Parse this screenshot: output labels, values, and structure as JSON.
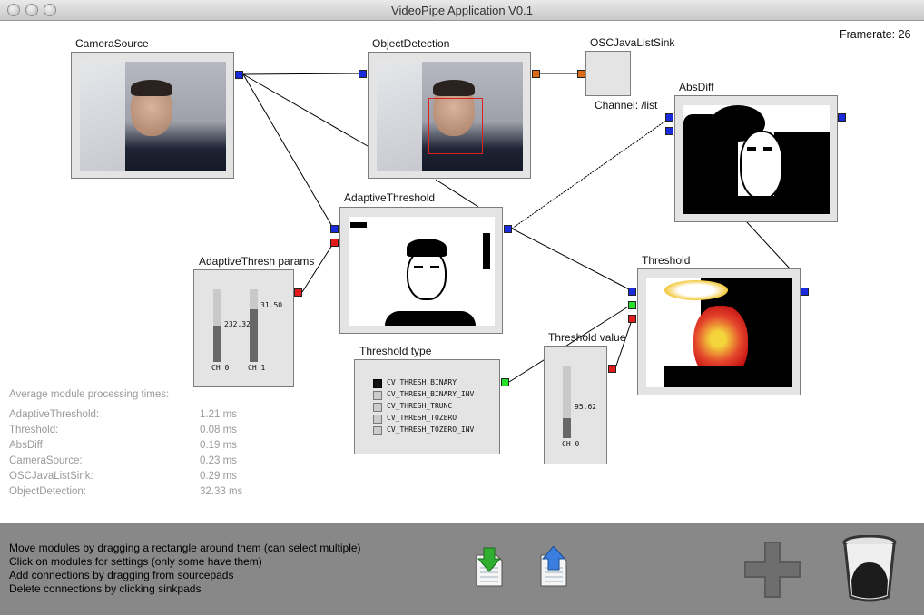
{
  "window": {
    "title": "VideoPipe Application V0.1"
  },
  "framerate": "Framerate: 26",
  "modules": {
    "camera_source": "CameraSource",
    "object_detection": "ObjectDetection",
    "osc_sink": "OSCJavaListSink",
    "osc_channel": "Channel: /list",
    "absdiff": "AbsDiff",
    "adaptive_threshold": "AdaptiveThreshold",
    "adaptive_params": "AdaptiveThresh params",
    "threshold": "Threshold",
    "threshold_type": "Threshold type",
    "threshold_value": "Threshold value"
  },
  "adaptive_params": {
    "ch0_value": "232.32",
    "ch0_label": "CH 0",
    "ch0_fraction": 0.5,
    "ch1_value": "31.50",
    "ch1_label": "CH 1",
    "ch1_fraction": 0.72
  },
  "threshold_value": {
    "value": "95.62",
    "label": "CH 0",
    "fraction": 0.27
  },
  "threshold_types": [
    {
      "label": "CV_THRESH_BINARY",
      "selected": true
    },
    {
      "label": "CV_THRESH_BINARY_INV",
      "selected": false
    },
    {
      "label": "CV_THRESH_TRUNC",
      "selected": false
    },
    {
      "label": "CV_THRESH_TOZERO",
      "selected": false
    },
    {
      "label": "CV_THRESH_TOZERO_INV",
      "selected": false
    }
  ],
  "stats": {
    "heading": "Average module processing times:",
    "rows": [
      {
        "name": "AdaptiveThreshold:",
        "value": "1.21 ms"
      },
      {
        "name": "Threshold:",
        "value": "0.08 ms"
      },
      {
        "name": "AbsDiff:",
        "value": "0.19 ms"
      },
      {
        "name": "CameraSource:",
        "value": "0.23 ms"
      },
      {
        "name": "OSCJavaListSink:",
        "value": "0.29 ms"
      },
      {
        "name": "ObjectDetection:",
        "value": "32.33 ms"
      }
    ]
  },
  "help": {
    "line1": "Move modules by dragging a rectangle around them (can select multiple)",
    "line2": "Click on modules for settings (only some have them)",
    "line3": "Add connections by dragging from sourcepads",
    "line4": "Delete connections by clicking sinkpads"
  },
  "icons": {
    "import": "import-icon",
    "export": "export-icon",
    "add": "plus-icon",
    "trash": "trash-icon"
  },
  "colors": {
    "pad_blue": "#1a2bdc",
    "pad_red": "#e31b1b",
    "pad_orange": "#dd6a18",
    "pad_green": "#26e02a"
  }
}
